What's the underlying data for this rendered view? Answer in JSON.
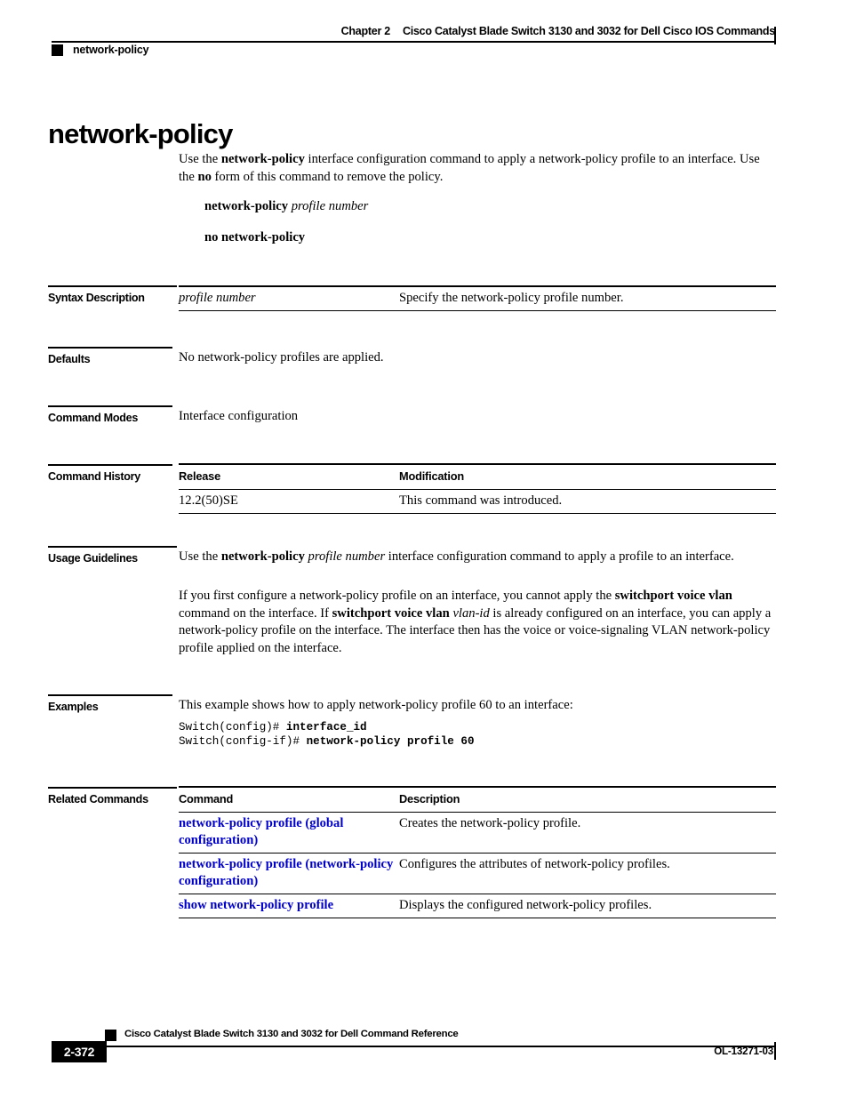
{
  "header": {
    "chapter": "Chapter 2",
    "book_title": "Cisco Catalyst Blade Switch 3130 and 3032 for Dell Cisco IOS Commands",
    "running_command": "network-policy"
  },
  "title": "network-policy",
  "intro": {
    "line1_a": "Use the ",
    "line1_b": "network-policy",
    "line1_c": " interface configuration command to apply a network-policy profile to an interface. Use the ",
    "line1_d": "no",
    "line1_e": " form of this command to remove the policy.",
    "syntax_bold": "network-policy",
    "syntax_italic": "profile number",
    "no_form": "no network-policy"
  },
  "sections": {
    "syntax_description": "Syntax Description",
    "defaults": "Defaults",
    "command_modes": "Command Modes",
    "command_history": "Command History",
    "usage_guidelines": "Usage Guidelines",
    "examples": "Examples",
    "related_commands": "Related Commands"
  },
  "syntax_table": {
    "rows": [
      {
        "term": "profile number",
        "description": "Specify the network-policy profile number."
      }
    ]
  },
  "defaults_text": "No network-policy profiles are applied.",
  "command_modes_text": "Interface configuration",
  "command_history": {
    "headers": [
      "Release",
      "Modification"
    ],
    "rows": [
      {
        "release": "12.2(50)SE",
        "modification": "This command was introduced."
      }
    ]
  },
  "usage": {
    "p1_a": "Use the ",
    "p1_b": "network-policy",
    "p1_c": " ",
    "p1_d": "profile number",
    "p1_e": " interface configuration command to apply a profile to an interface.",
    "p2_a": "If you first configure a network-policy profile on an interface, you cannot apply the ",
    "p2_b": "switchport voice vlan",
    "p2_c": " command on the interface. If ",
    "p2_d": "switchport voice vlan",
    "p2_e": " ",
    "p2_f": "vlan-id",
    "p2_g": " is already configured on an interface, you can apply a network-policy profile on the interface. The interface then has the voice or voice-signaling VLAN network-policy profile applied on the interface."
  },
  "examples": {
    "intro": "This example shows how to apply network-policy profile 60 to an interface:",
    "lines": [
      {
        "prompt": "Switch(config)# ",
        "command": "interface_id"
      },
      {
        "prompt": "Switch(config-if)# ",
        "command": "network-policy profile 60"
      }
    ]
  },
  "related_commands": {
    "headers": [
      "Command",
      "Description"
    ],
    "rows": [
      {
        "command": "network-policy profile (global configuration)",
        "description": "Creates the network-policy profile."
      },
      {
        "command": "network-policy profile (network-policy configuration)",
        "description": "Configures the attributes of network-policy profiles."
      },
      {
        "command": "show network-policy profile",
        "description": "Displays the configured network-policy profiles."
      }
    ]
  },
  "footer": {
    "book_title": "Cisco Catalyst Blade Switch 3130 and 3032 for Dell Command Reference",
    "page_number": "2-372",
    "doc_id": "OL-13271-03"
  },
  "colors": {
    "link": "#0000CC",
    "rule": "#000000",
    "page_bg": "#FFFFFF"
  }
}
